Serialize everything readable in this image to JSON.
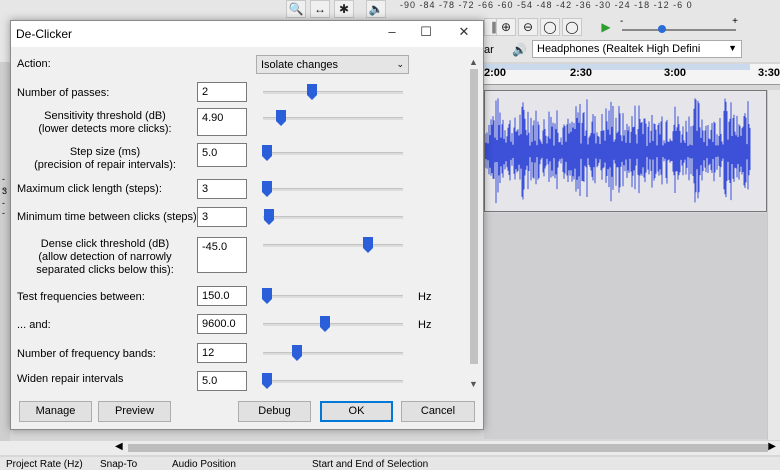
{
  "background": {
    "meter_scale": "-90  -84  -78  -72  -66  -60  -54  -48  -42  -36  -30  -24  -18  -12  -6   0",
    "meter_scale_right": "-90 -84 -78 -72 -66 -60 -54 -48 -42 -36 -30 -24 -18 -12 -6 0",
    "device_prefix": "ar",
    "output_device": "Headphones (Realtek High Defini",
    "ruler_ticks": [
      "2:00",
      "2:30",
      "3:00",
      "3:30"
    ],
    "left_marks": [
      "-",
      "-",
      "-",
      "3",
      "-"
    ],
    "status": {
      "project_rate": "Project Rate (Hz)",
      "snap_to": "Snap-To",
      "audio_position": "Audio Position",
      "selection": "Start and End of Selection"
    },
    "waveform_color": "#3c50d8"
  },
  "dialog": {
    "title": "De-Clicker",
    "window_controls": {
      "minimize": "–",
      "maximize": "☐",
      "close": "✕"
    },
    "action_label": "Action:",
    "action_value": "Isolate changes",
    "params": [
      {
        "label": "Number of passes:",
        "value": "2",
        "level": 0.35,
        "unit": ""
      },
      {
        "label": "Sensitivity threshold (dB)\n(lower detects more clicks):",
        "value": "4.90",
        "level": 0.13,
        "unit": ""
      },
      {
        "label": "Step size (ms)\n(precision of repair intervals):",
        "value": "5.0",
        "level": 0.03,
        "unit": ""
      },
      {
        "label": "Maximum click length (steps):",
        "value": "3",
        "level": 0.03,
        "unit": ""
      },
      {
        "label": "Minimum time between clicks (steps):",
        "value": "3",
        "level": 0.04,
        "unit": ""
      },
      {
        "label": "Dense click threshold (dB)\n(allow detection of narrowly\nseparated clicks below this):",
        "value": "-45.0",
        "level": 0.75,
        "unit": ""
      },
      {
        "label": "Test frequencies between:",
        "value": "150.0",
        "level": 0.03,
        "unit": "Hz"
      },
      {
        "label": "... and:",
        "value": "9600.0",
        "level": 0.44,
        "unit": "Hz"
      },
      {
        "label": "Number of frequency bands:",
        "value": "12",
        "level": 0.24,
        "unit": ""
      },
      {
        "label": "Widen repair intervals",
        "value": "5.0",
        "level": 0.03,
        "unit": ""
      }
    ],
    "buttons": {
      "manage": "Manage",
      "preview": "Preview",
      "debug": "Debug",
      "ok": "OK",
      "cancel": "Cancel"
    },
    "accent_color": "#2b5fd9"
  }
}
